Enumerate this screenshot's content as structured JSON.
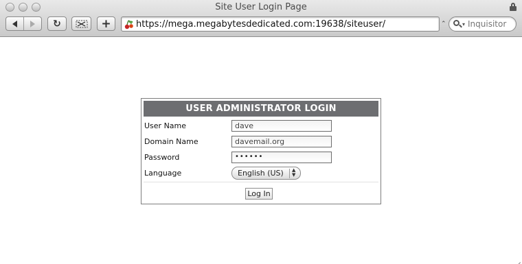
{
  "window": {
    "title": "Site User Login Page"
  },
  "toolbar": {
    "reload_glyph": "↻",
    "new_tab_glyph": "+",
    "address": "https://mega.megabytesdedicated.com:19638/siteuser/",
    "search_placeholder": "Inquisitor"
  },
  "login": {
    "header": "USER ADMINISTRATOR LOGIN",
    "fields": {
      "username": {
        "label": "User Name",
        "value": "dave"
      },
      "domain": {
        "label": "Domain Name",
        "value": "davemail.org"
      },
      "password": {
        "label": "Password",
        "value": "••••••"
      },
      "language": {
        "label": "Language",
        "value": "English (US)"
      }
    },
    "submit_label": "Log In"
  },
  "colors": {
    "header_bg": "#6d6e71",
    "header_text": "#ffffff",
    "chrome_top": "#e9e9e9",
    "chrome_bottom": "#c9c9c9"
  },
  "icons": {
    "window_buttons": [
      "close-icon",
      "minimize-icon",
      "zoom-icon"
    ],
    "lock": "lock-icon",
    "back": "back-arrow-icon",
    "forward": "forward-arrow-icon",
    "reload": "reload-icon",
    "snip": "scissors-icon",
    "add": "plus-icon",
    "favicon": "cherry-icon",
    "search": "magnifier-icon",
    "resize": "resize-grip-icon"
  }
}
